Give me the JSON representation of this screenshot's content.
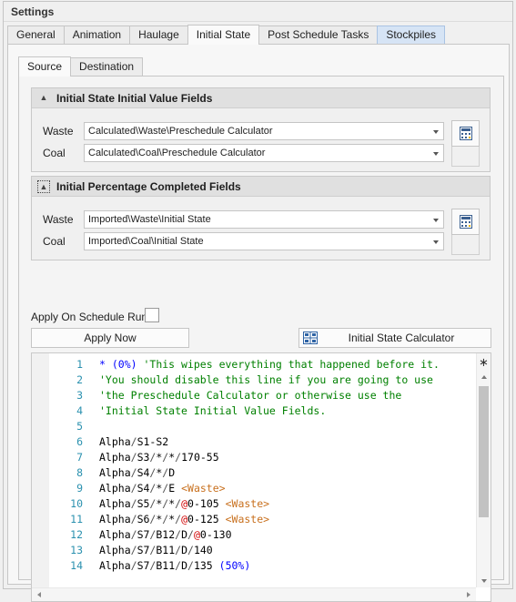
{
  "window": {
    "title": "Settings"
  },
  "tabs": [
    {
      "label": "General"
    },
    {
      "label": "Animation"
    },
    {
      "label": "Haulage"
    },
    {
      "label": "Initial State"
    },
    {
      "label": "Post Schedule Tasks"
    },
    {
      "label": "Stockpiles"
    }
  ],
  "active_tab": "Initial State",
  "subtabs": [
    {
      "label": "Source"
    },
    {
      "label": "Destination"
    }
  ],
  "active_subtab": "Source",
  "group_initial_value": {
    "title": "Initial State Initial Value Fields",
    "collapse_icon": "chevron-up-icon",
    "waste_label": "Waste",
    "waste_value": "Calculated\\Waste\\Preschedule Calculator",
    "coal_label": "Coal",
    "coal_value": "Calculated\\Coal\\Preschedule Calculator"
  },
  "group_percentage": {
    "title": "Initial Percentage Completed Fields",
    "collapse_icon": "chevron-up-icon",
    "waste_label": "Waste",
    "waste_value": "Imported\\Waste\\Initial State",
    "coal_label": "Coal",
    "coal_value": "Imported\\Coal\\Initial State"
  },
  "apply_on_schedule_run": {
    "label": "Apply On Schedule Run",
    "checked": false
  },
  "apply_now_button": "Apply Now",
  "initial_state_calculator_button": "Initial State Calculator",
  "editor": {
    "lines": [
      {
        "num": "1",
        "segs": [
          [
            "* ",
            "blue"
          ],
          [
            "(0%)",
            "blue"
          ],
          [
            " 'This wipes everything that happened before it.",
            "comment"
          ]
        ]
      },
      {
        "num": "2",
        "segs": [
          [
            "'You should disable this line if you are going to use",
            "comment"
          ]
        ]
      },
      {
        "num": "3",
        "segs": [
          [
            "'the Preschedule Calculator or otherwise use the",
            "comment"
          ]
        ]
      },
      {
        "num": "4",
        "segs": [
          [
            "'Initial State Initial Value Fields.",
            "comment"
          ]
        ]
      },
      {
        "num": "5",
        "segs": []
      },
      {
        "num": "6",
        "segs": [
          [
            "Alpha",
            "black"
          ],
          [
            "/",
            "slash"
          ],
          [
            "S1-S2",
            "black"
          ]
        ]
      },
      {
        "num": "7",
        "segs": [
          [
            "Alpha",
            "black"
          ],
          [
            "/",
            "slash"
          ],
          [
            "S3",
            "black"
          ],
          [
            "/",
            "slash"
          ],
          [
            "*",
            "black"
          ],
          [
            "/",
            "slash"
          ],
          [
            "*",
            "black"
          ],
          [
            "/",
            "slash"
          ],
          [
            "170-55",
            "black"
          ]
        ]
      },
      {
        "num": "8",
        "segs": [
          [
            "Alpha",
            "black"
          ],
          [
            "/",
            "slash"
          ],
          [
            "S4",
            "black"
          ],
          [
            "/",
            "slash"
          ],
          [
            "*",
            "black"
          ],
          [
            "/",
            "slash"
          ],
          [
            "D",
            "black"
          ]
        ]
      },
      {
        "num": "9",
        "segs": [
          [
            "Alpha",
            "black"
          ],
          [
            "/",
            "slash"
          ],
          [
            "S4",
            "black"
          ],
          [
            "/",
            "slash"
          ],
          [
            "*",
            "black"
          ],
          [
            "/",
            "slash"
          ],
          [
            "E ",
            "black"
          ],
          [
            "<Waste>",
            "orange"
          ]
        ]
      },
      {
        "num": "10",
        "segs": [
          [
            "Alpha",
            "black"
          ],
          [
            "/",
            "slash"
          ],
          [
            "S5",
            "black"
          ],
          [
            "/",
            "slash"
          ],
          [
            "*",
            "black"
          ],
          [
            "/",
            "slash"
          ],
          [
            "*",
            "black"
          ],
          [
            "/",
            "slash"
          ],
          [
            "@",
            "red"
          ],
          [
            "0-105 ",
            "black"
          ],
          [
            "<Waste>",
            "orange"
          ]
        ]
      },
      {
        "num": "11",
        "segs": [
          [
            "Alpha",
            "black"
          ],
          [
            "/",
            "slash"
          ],
          [
            "S6",
            "black"
          ],
          [
            "/",
            "slash"
          ],
          [
            "*",
            "black"
          ],
          [
            "/",
            "slash"
          ],
          [
            "*",
            "black"
          ],
          [
            "/",
            "slash"
          ],
          [
            "@",
            "red"
          ],
          [
            "0-125 ",
            "black"
          ],
          [
            "<Waste>",
            "orange"
          ]
        ]
      },
      {
        "num": "12",
        "segs": [
          [
            "Alpha",
            "black"
          ],
          [
            "/",
            "slash"
          ],
          [
            "S7",
            "black"
          ],
          [
            "/",
            "slash"
          ],
          [
            "B12",
            "black"
          ],
          [
            "/",
            "slash"
          ],
          [
            "D",
            "black"
          ],
          [
            "/",
            "slash"
          ],
          [
            "@",
            "red"
          ],
          [
            "0-130",
            "black"
          ]
        ]
      },
      {
        "num": "13",
        "segs": [
          [
            "Alpha",
            "black"
          ],
          [
            "/",
            "slash"
          ],
          [
            "S7",
            "black"
          ],
          [
            "/",
            "slash"
          ],
          [
            "B11",
            "black"
          ],
          [
            "/",
            "slash"
          ],
          [
            "D",
            "black"
          ],
          [
            "/",
            "slash"
          ],
          [
            "140",
            "black"
          ]
        ]
      },
      {
        "num": "14",
        "segs": [
          [
            "Alpha",
            "black"
          ],
          [
            "/",
            "slash"
          ],
          [
            "S7",
            "black"
          ],
          [
            "/",
            "slash"
          ],
          [
            "B11",
            "black"
          ],
          [
            "/",
            "slash"
          ],
          [
            "D",
            "black"
          ],
          [
            "/",
            "slash"
          ],
          [
            "135 ",
            "black"
          ],
          [
            "(50%)",
            "blue"
          ]
        ]
      }
    ]
  },
  "colors": {
    "stockpiles_tab": "#d6e4f5",
    "line_number": "#2b91af",
    "comment": "#008000",
    "keyword_blue": "#0000ff",
    "tag_orange": "#c8701e",
    "at_red": "#d00000"
  }
}
